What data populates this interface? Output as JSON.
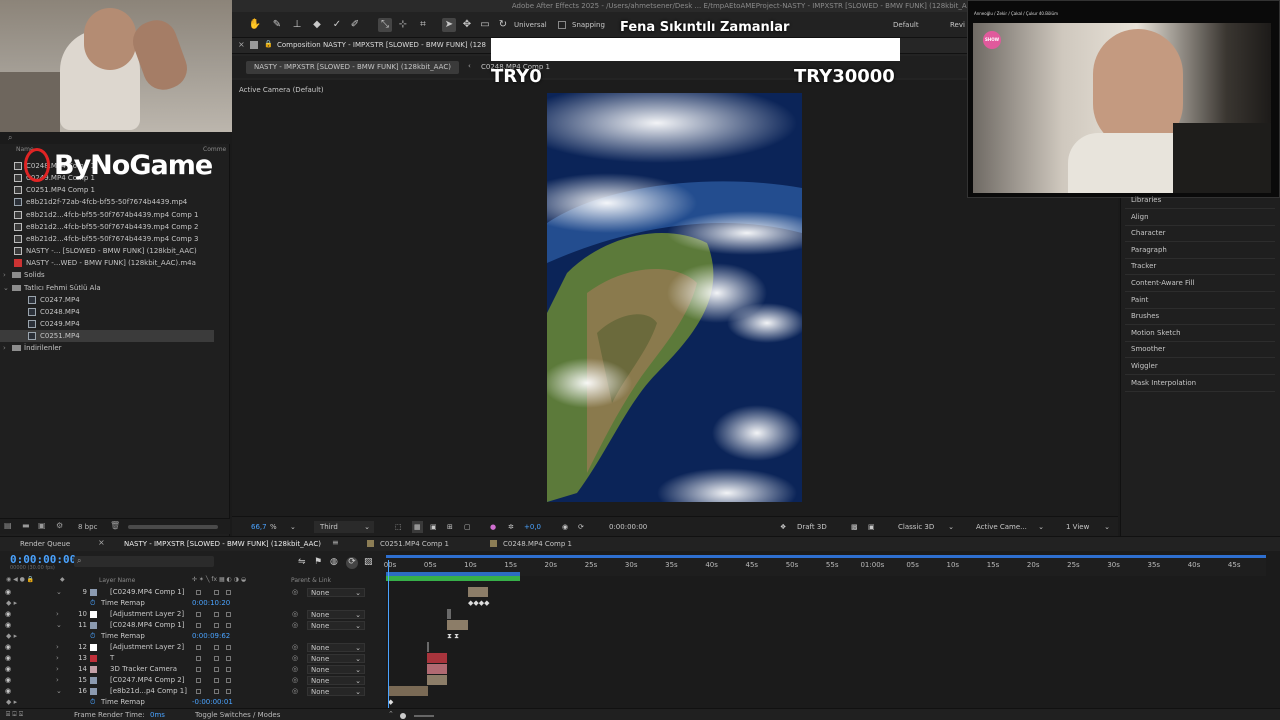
{
  "app": {
    "title": "Adobe After Effects 2025 - /Users/ahmetsener/Desk ... E/tmpAEtoAMEProject-NASTY - IMPXSTR [SLOWED - BMW FUNK] (128kbit_AAC).aep *"
  },
  "toolbar": {
    "universal_label": "Universal",
    "snapping_label": "Snapping",
    "workspace_default": "Default",
    "workspace_review": "Revi"
  },
  "overlay": {
    "song_title": "Fena Sıkıntılı Zamanlar",
    "left_amount": "TRY0",
    "right_amount": "TRY30000",
    "logo_text": "ByNoGame"
  },
  "webcam_right": {
    "caption": "Anneoğlu / Zekir / Çakal / Çukur 40.Bölüm",
    "channel_logo": "SHOW"
  },
  "composition": {
    "tab_title": "Composition NASTY - IMPXSTR [SLOWED - BMW FUNK] (128",
    "subtab_active": "NASTY - IMPXSTR [SLOWED - BMW FUNK] (128kbit_AAC)",
    "subtab_other": "C0248.MP4 Comp 1",
    "camera_label": "Active Camera (Default)"
  },
  "viewer_footer": {
    "zoom": "66,7",
    "zoom_unit": "%",
    "resolution": "Third",
    "exposure": "+0,0",
    "timecode": "0:00:00:00",
    "draft": "Draft 3D",
    "renderer": "Classic 3D",
    "camera": "Active Came...",
    "view": "1 View"
  },
  "project": {
    "col_name": "Name",
    "col_comment": "Comme",
    "bpc": "8 bpc",
    "items": [
      {
        "name": "C0248.MP4 Comp 1",
        "icon": "comp-icon",
        "indent": 1
      },
      {
        "name": "C0249.MP4 Comp 1",
        "icon": "comp-icon",
        "indent": 1
      },
      {
        "name": "C0251.MP4 Comp 1",
        "icon": "comp-icon",
        "indent": 1
      },
      {
        "name": "e8b21d2f-72ab-4fcb-bf55-50f7674b4439.mp4",
        "icon": "video-icon",
        "indent": 1
      },
      {
        "name": "e8b21d2...4fcb-bf55-50f7674b4439.mp4 Comp 1",
        "icon": "comp-icon",
        "indent": 1
      },
      {
        "name": "e8b21d2...4fcb-bf55-50f7674b4439.mp4 Comp 2",
        "icon": "comp-icon",
        "indent": 1
      },
      {
        "name": "e8b21d2...4fcb-bf55-50f7674b4439.mp4 Comp 3",
        "icon": "comp-icon",
        "indent": 1
      },
      {
        "name": "NASTY -... [SLOWED - BMW FUNK] (128kbit_AAC)",
        "icon": "comp-icon",
        "indent": 1
      },
      {
        "name": "NASTY -...WED - BMW FUNK] (128kbit_AAC).m4a",
        "icon": "audio-icon",
        "indent": 1
      },
      {
        "name": "Solids",
        "icon": "folder-icon",
        "indent": 0
      },
      {
        "name": "Tatlıcı Fehmi Sütlü Ala",
        "icon": "folder-icon",
        "indent": 0
      },
      {
        "name": "C0247.MP4",
        "icon": "video-icon",
        "indent": 2
      },
      {
        "name": "C0248.MP4",
        "icon": "video-icon",
        "indent": 2
      },
      {
        "name": "C0249.MP4",
        "icon": "video-icon",
        "indent": 2
      },
      {
        "name": "C0251.MP4",
        "icon": "video-icon",
        "indent": 2,
        "selected": true
      },
      {
        "name": "İndirilenler",
        "icon": "folder-icon",
        "indent": 0
      }
    ]
  },
  "right_panel": {
    "items": [
      "Libraries",
      "Align",
      "Character",
      "Paragraph",
      "Tracker",
      "Content-Aware Fill",
      "Paint",
      "Brushes",
      "Motion Sketch",
      "Smoother",
      "Wiggler",
      "Mask Interpolation"
    ]
  },
  "timeline": {
    "tabs": [
      "Render Queue",
      "NASTY - IMPXSTR [SLOWED - BMW FUNK] (128kbit_AAC)",
      "C0251.MP4 Comp 1",
      "C0248.MP4 Comp 1"
    ],
    "timecode": "0:00:00:00",
    "timecode_sub": "00000 (30.00 fps)",
    "col_layer_name": "Layer Name",
    "col_parent": "Parent & Link",
    "ruler": [
      "00s",
      "05s",
      "10s",
      "15s",
      "20s",
      "25s",
      "30s",
      "35s",
      "40s",
      "45s",
      "50s",
      "55s",
      "01:00s",
      "05s",
      "10s",
      "15s",
      "20s",
      "25s",
      "30s",
      "35s",
      "40s",
      "45s"
    ],
    "layers": [
      {
        "num": "9",
        "name": "[C0249.MP4 Comp 1]",
        "color": "#8b9ab0",
        "parent": "None",
        "prop": {
          "name": "Time Remap",
          "value": "0:00:10:20"
        }
      },
      {
        "num": "10",
        "name": "[Adjustment Layer 2]",
        "color": "#ffffff",
        "parent": "None"
      },
      {
        "num": "11",
        "name": "[C0248.MP4 Comp 1]",
        "color": "#8b9ab0",
        "parent": "None",
        "prop": {
          "name": "Time Remap",
          "value": "0:00:09:62"
        }
      },
      {
        "num": "12",
        "name": "[Adjustment Layer 2]",
        "color": "#ffffff",
        "parent": "None"
      },
      {
        "num": "13",
        "name": "T",
        "color": "#c0303a",
        "parent": "None"
      },
      {
        "num": "14",
        "name": "3D Tracker Camera",
        "color": "#c4a1a8",
        "parent": "None"
      },
      {
        "num": "15",
        "name": "[C0247.MP4 Comp 2]",
        "color": "#8b9ab0",
        "parent": "None"
      },
      {
        "num": "16",
        "name": "[e8b21d...p4 Comp 1]",
        "color": "#8b9ab0",
        "parent": "None",
        "prop": {
          "name": "Time Remap",
          "value": "-0:00:00:01"
        }
      }
    ],
    "frame_render_label": "Frame Render Time:",
    "frame_render_value": "0ms",
    "toggle_label": "Toggle Switches / Modes"
  }
}
